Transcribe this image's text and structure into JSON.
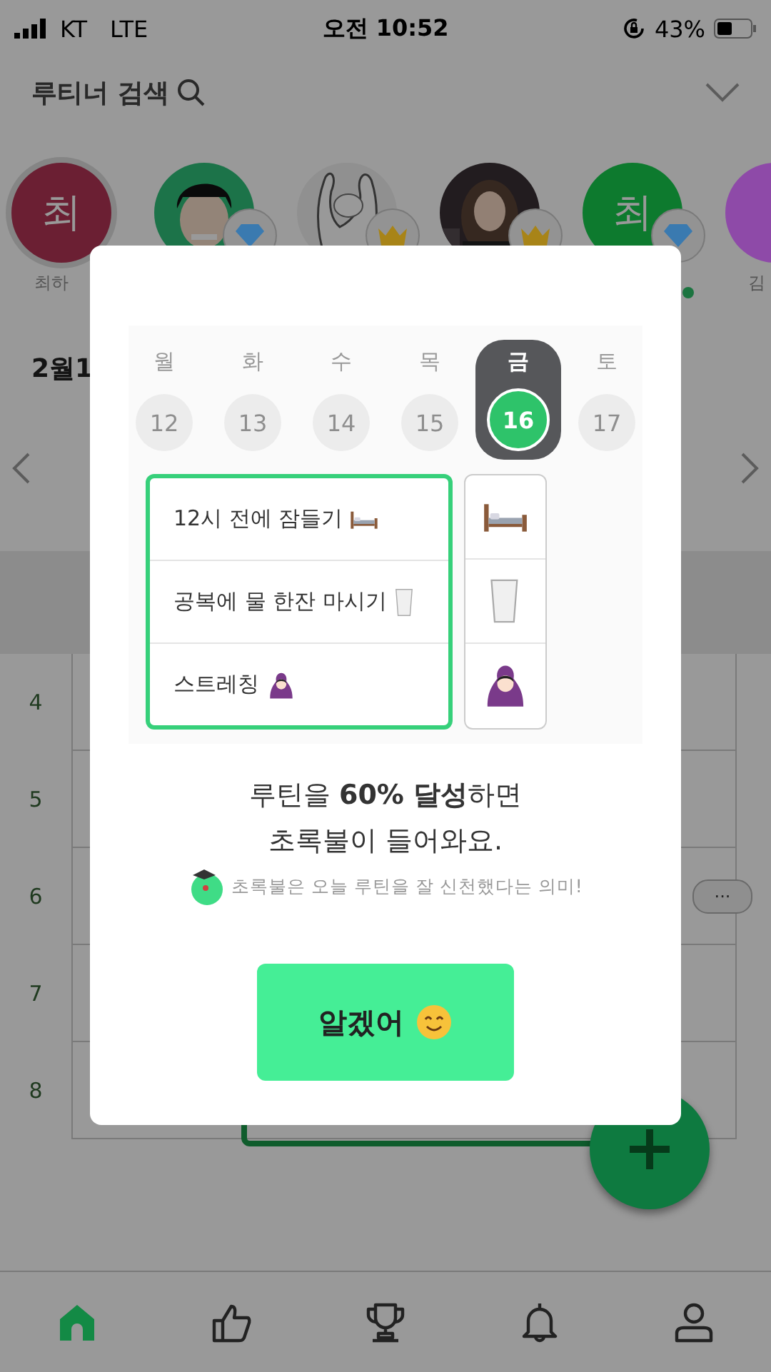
{
  "status_bar": {
    "carrier": "KT",
    "network": "LTE",
    "time": "오전 10:52",
    "battery": "43%"
  },
  "header": {
    "title": "루티너 검색"
  },
  "friends": [
    {
      "kind": "initial",
      "initial": "최",
      "name": "최하",
      "color": "#6b1f33",
      "selected": true
    },
    {
      "kind": "picture",
      "badge": {
        "kind": "diamond"
      },
      "selected": false
    },
    {
      "kind": "picture",
      "badge": {
        "kind": "crown"
      },
      "selected": false
    },
    {
      "kind": "picture",
      "badge": {
        "kind": "crown"
      },
      "selected": false
    },
    {
      "kind": "initial",
      "initial": "최",
      "color": "#0d7a2e",
      "badge": {
        "kind": "diamond"
      },
      "online": true,
      "selected": false
    },
    {
      "kind": "initial",
      "name": "김",
      "color": "#8e4aa8",
      "selected": false
    }
  ],
  "week": {
    "month_label": "2월1"
  },
  "table": {
    "rows": [
      {
        "number": "4"
      },
      {
        "number": "5"
      },
      {
        "number": "6",
        "more": "···"
      },
      {
        "number": "7"
      },
      {
        "number": "8",
        "kind": "routine"
      }
    ]
  },
  "modal": {
    "days": [
      {
        "day": "월",
        "date": "12",
        "selected": false
      },
      {
        "day": "화",
        "date": "13",
        "selected": false
      },
      {
        "day": "수",
        "date": "14",
        "selected": false
      },
      {
        "day": "목",
        "date": "15",
        "selected": false
      },
      {
        "day": "금",
        "date": "16",
        "selected": true
      },
      {
        "day": "토",
        "date": "17",
        "selected": false
      }
    ],
    "routines": [
      {
        "label": "12시 전에 잠들기",
        "kind": "bed"
      },
      {
        "label": "공복에 물 한잔 마시기",
        "kind": "milk"
      },
      {
        "label": "스트레칭",
        "kind": "stretch"
      }
    ],
    "message": [
      "루틴을 **60% 달성**하면",
      "초록불이 들어와요."
    ],
    "note": "초록불은 오늘 루틴을 잘 신천했다는 의미!",
    "button": "알겠어"
  },
  "tabs": [
    {
      "kind": "home",
      "selected": true
    },
    {
      "kind": "like",
      "selected": false
    },
    {
      "kind": "trophy",
      "selected": false
    },
    {
      "kind": "bell",
      "selected": false
    },
    {
      "kind": "profile",
      "selected": false
    }
  ]
}
